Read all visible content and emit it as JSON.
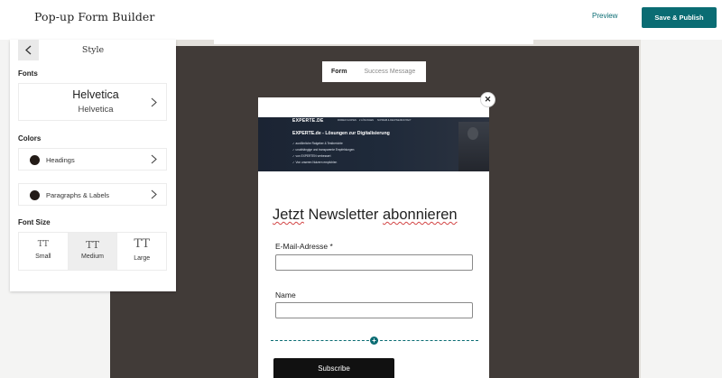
{
  "app": {
    "title": "Pop-up Form Builder",
    "preview_label": "Preview",
    "publish_label": "Save & Publish",
    "accent_color": "#0a6c73"
  },
  "sidebar": {
    "back_icon": "chevron-left-icon",
    "title": "Style",
    "fonts": {
      "section_label": "Fonts",
      "heading_font": "Helvetica",
      "body_font": "Helvetica"
    },
    "colors": {
      "section_label": "Colors",
      "items": [
        {
          "label": "Headings",
          "swatch": "#231b17"
        },
        {
          "label": "Paragraphs & Labels",
          "swatch": "#231b17"
        }
      ]
    },
    "font_size": {
      "section_label": "Font Size",
      "options": [
        {
          "glyph": "TT",
          "label": "Small"
        },
        {
          "glyph": "TT",
          "label": "Medium"
        },
        {
          "glyph": "TT",
          "label": "Large"
        }
      ],
      "selected": "Medium"
    }
  },
  "form_tabs": {
    "items": [
      "Form",
      "Success Message"
    ],
    "active": "Form"
  },
  "popup": {
    "close_icon": "close-icon",
    "banner": {
      "logo": "EXPERTE.DE",
      "nav": [
        "FIRMEN SUCHEN",
        "2 LÖSUNGEN",
        "SCHREIB & RECHNEN",
        "KONTAKT"
      ],
      "heading": "EXPERTE.de - Lösungen zur Digitalisierung",
      "bullets": [
        "✓ ausführliche Ratgeber & Testberichte",
        "✓ unabhängige und transparente Empfehlungen",
        "✓ von EXPERTEN verbessert",
        "✓ Von unseren Nutzern empfohlen"
      ]
    },
    "headline_words": [
      "Jetzt",
      "Newsletter",
      "abonnieren"
    ],
    "fields": [
      {
        "label": "E-Mail-Adresse *",
        "value": ""
      },
      {
        "label": "Name",
        "value": ""
      }
    ],
    "add_block_icon": "plus-icon",
    "subscribe_label": "Subscribe"
  }
}
